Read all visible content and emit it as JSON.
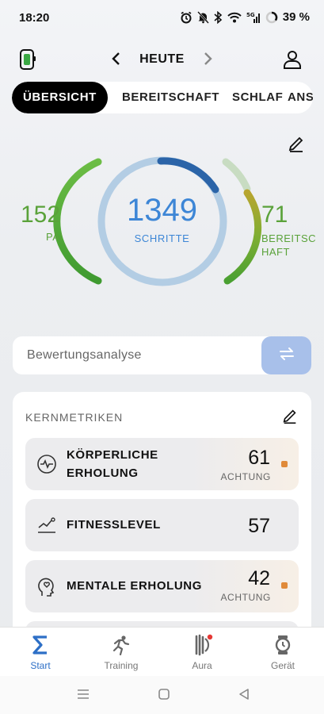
{
  "status": {
    "time": "18:20",
    "battery": "39 %"
  },
  "header": {
    "title": "HEUTE"
  },
  "tabs": [
    {
      "label": "ÜBERSICHT",
      "active": true
    },
    {
      "label": "BEREITSCHAFT",
      "active": false
    },
    {
      "label": "SCHLAF",
      "active": false
    },
    {
      "label": "ANS",
      "active": false
    }
  ],
  "rings": {
    "pai": {
      "value": "152",
      "label": "PAI"
    },
    "steps": {
      "value": "1349",
      "label": "SCHRITTE"
    },
    "readiness": {
      "value": "71",
      "label": "BEREITSC HAFT"
    }
  },
  "analysis": {
    "label": "Bewertungsanalyse"
  },
  "card": {
    "title": "KERNMETRIKEN",
    "rows": [
      {
        "label_line1": "KÖRPERLICHE",
        "label_line2": "ERHOLUNG",
        "value": "61",
        "status": "ACHTUNG",
        "icon": "pulse-icon"
      },
      {
        "label_line1": "FITNESSLEVEL",
        "label_line2": "",
        "value": "57",
        "status": "",
        "icon": "trend-icon"
      },
      {
        "label_line1": "MENTALE ERHOLUNG",
        "label_line2": "",
        "value": "42",
        "status": "ACHTUNG",
        "icon": "head-heart-icon"
      }
    ]
  },
  "nav": [
    {
      "label": "Start",
      "icon": "sigma-icon",
      "active": true
    },
    {
      "label": "Training",
      "icon": "runner-icon",
      "active": false
    },
    {
      "label": "Aura",
      "icon": "aura-icon",
      "active": false
    },
    {
      "label": "Gerät",
      "icon": "watch-icon",
      "active": false
    }
  ],
  "colors": {
    "accent_blue": "#3d86d6",
    "accent_green": "#5aa23a",
    "warning_orange": "#e08a3a",
    "nav_active": "#2d6fc6"
  }
}
